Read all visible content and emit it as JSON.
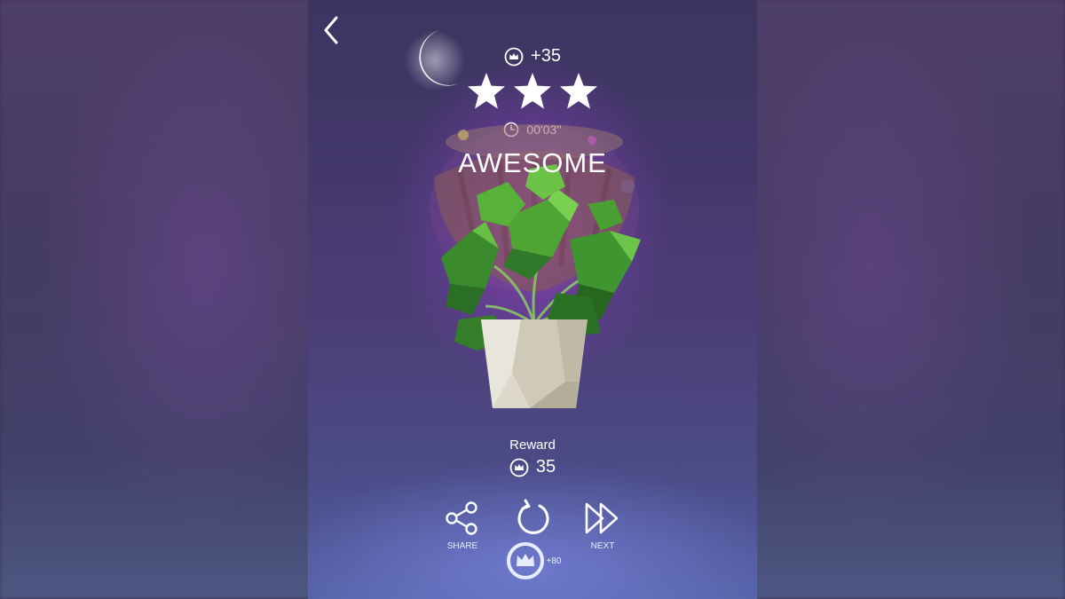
{
  "header": {
    "back_icon": "chevron-left-icon",
    "crown_icon": "crown-icon",
    "crown_bonus": "+35",
    "stars_earned": 3,
    "stars_total": 3,
    "time_icon": "clock-icon",
    "time": "00'03''",
    "result_title": "AWESOME"
  },
  "scene": {
    "moon_icon": "crescent-moon-icon",
    "plant": "potted-plant-illustration"
  },
  "reward": {
    "label": "Reward",
    "amount": "35"
  },
  "actions": {
    "share": {
      "label": "SHARE",
      "icon": "share-icon"
    },
    "retry": {
      "label": "+80",
      "icon": "replay-icon"
    },
    "next": {
      "label": "NEXT",
      "icon": "fast-forward-icon"
    }
  },
  "colors": {
    "text": "#ffffff",
    "leaf_dark": "#2f7a2a",
    "leaf_light": "#5dbb3a",
    "pot": "#d8d4c6"
  }
}
